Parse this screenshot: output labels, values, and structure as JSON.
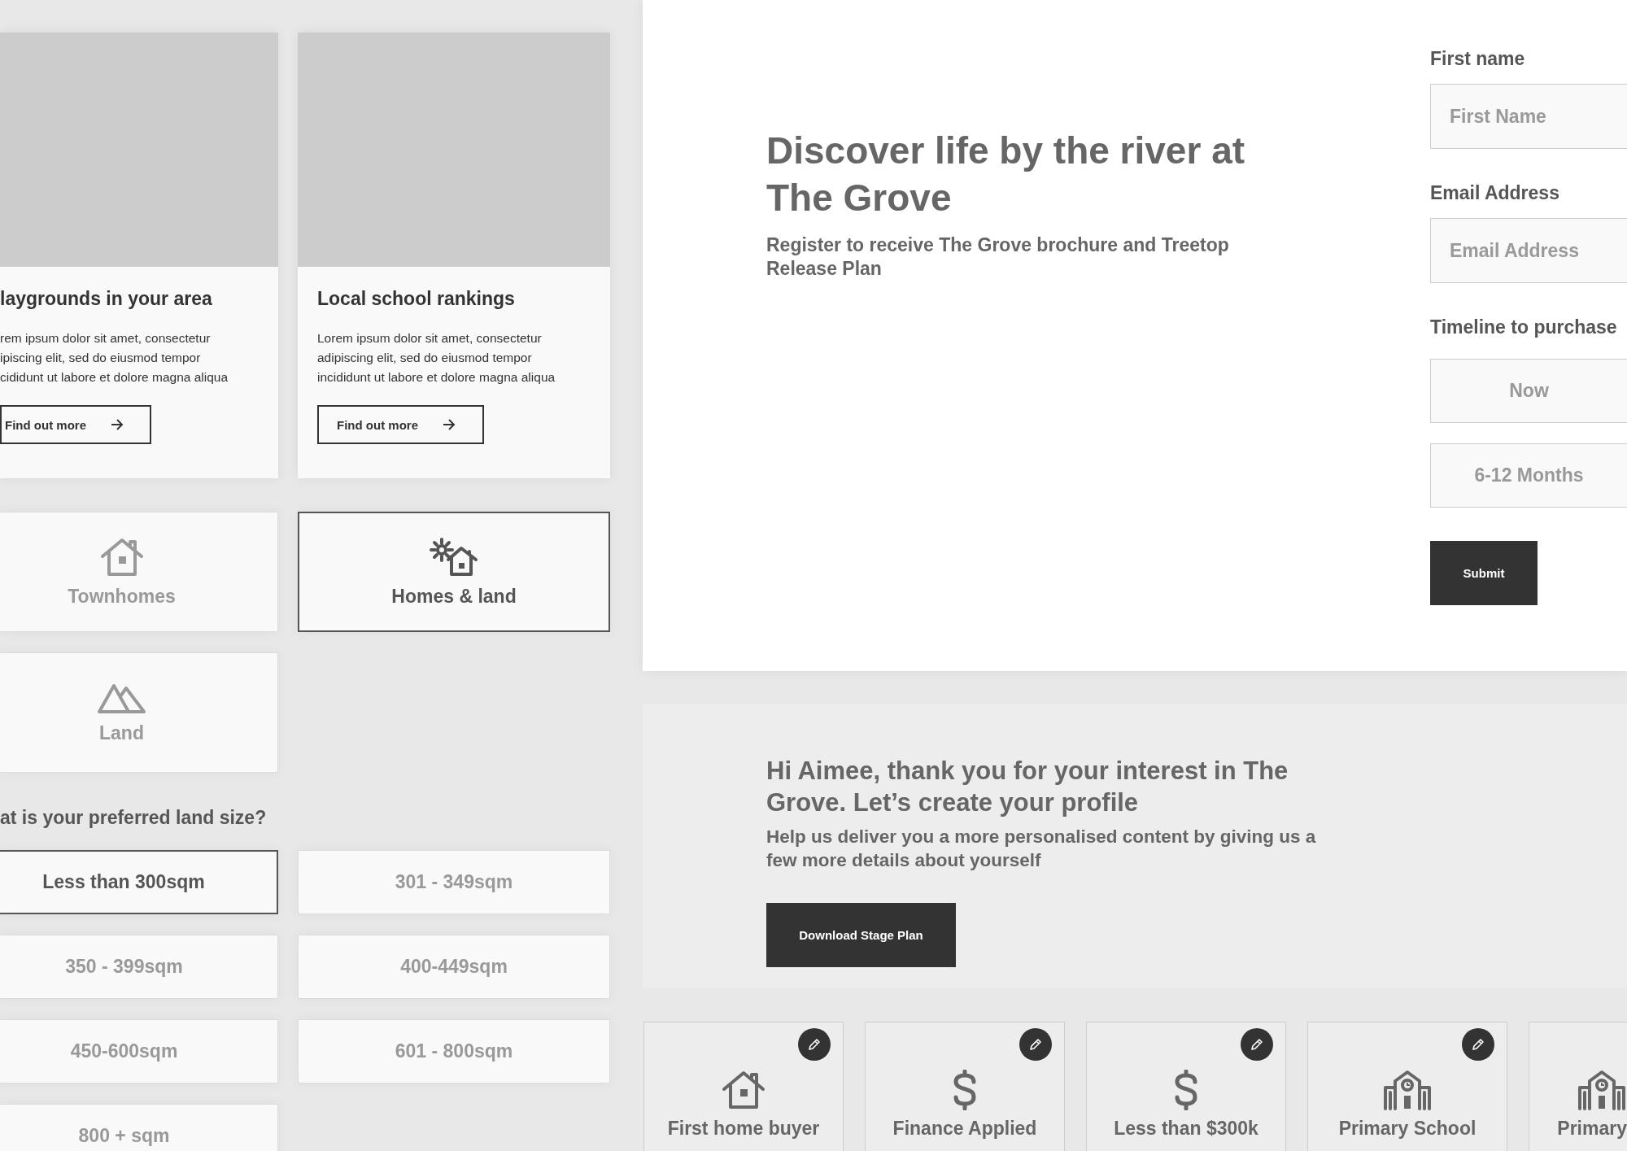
{
  "cards": [
    {
      "title": "laygrounds in your area",
      "lines": [
        "rem ipsum dolor sit amet, consectetur",
        "ipiscing elit, sed do eiusmod tempor",
        "cididunt ut labore et dolore magna aliqua"
      ],
      "button": "Find out more"
    },
    {
      "title": "Local school rankings",
      "lines": [
        "Lorem ipsum dolor sit amet, consectetur",
        "adipiscing elit, sed do eiusmod tempor",
        "incididunt ut labore et dolore magna aliqua"
      ],
      "button": "Find out more"
    }
  ],
  "property_types": [
    {
      "kind": "townhome",
      "label": "Townhomes",
      "selected": false
    },
    {
      "kind": "house-and-land",
      "label": "Homes & land",
      "selected": true
    },
    {
      "kind": "land",
      "label": "Land",
      "selected": false
    }
  ],
  "land_size": {
    "question": "at is your preferred land size?",
    "options": [
      {
        "label": "Less than 300sqm",
        "selected": true
      },
      {
        "label": "301 - 349sqm",
        "selected": false
      },
      {
        "label": "350 - 399sqm",
        "selected": false
      },
      {
        "label": "400-449sqm",
        "selected": false
      },
      {
        "label": "450-600sqm",
        "selected": false
      },
      {
        "label": "601 - 800sqm",
        "selected": false
      },
      {
        "label": "800 + sqm",
        "selected": false
      }
    ]
  },
  "hero": {
    "title": "Discover life by the river at The Grove",
    "subtitle": "Register to receive The Grove brochure and Treetop Release Plan"
  },
  "form": {
    "fields": [
      {
        "label": "First name",
        "placeholder": "First Name"
      },
      {
        "label": "Email Address",
        "placeholder": "Email Address"
      }
    ],
    "timeline": {
      "label": "Timeline to purchase",
      "options": [
        {
          "label": "Now",
          "selected": false
        },
        {
          "label": "6-12 Months",
          "selected": false
        }
      ]
    },
    "submit": "Submit"
  },
  "profile": {
    "title": "Hi Aimee, thank you for your interest in The Grove. Let’s create your profile",
    "subtitle": "Help us deliver you a more personalised content by giving us a few more details about yourself",
    "button": "Download Stage Plan"
  },
  "profile_tags": [
    {
      "kind": "house",
      "label": "First home buyer",
      "editable": true
    },
    {
      "kind": "dollar",
      "label": "Finance Applied",
      "editable": true
    },
    {
      "kind": "dollar",
      "label": "Less than $300k",
      "editable": true
    },
    {
      "kind": "school",
      "label": "Primary School",
      "editable": true
    },
    {
      "kind": "school",
      "label": "Primary",
      "editable": false
    }
  ]
}
